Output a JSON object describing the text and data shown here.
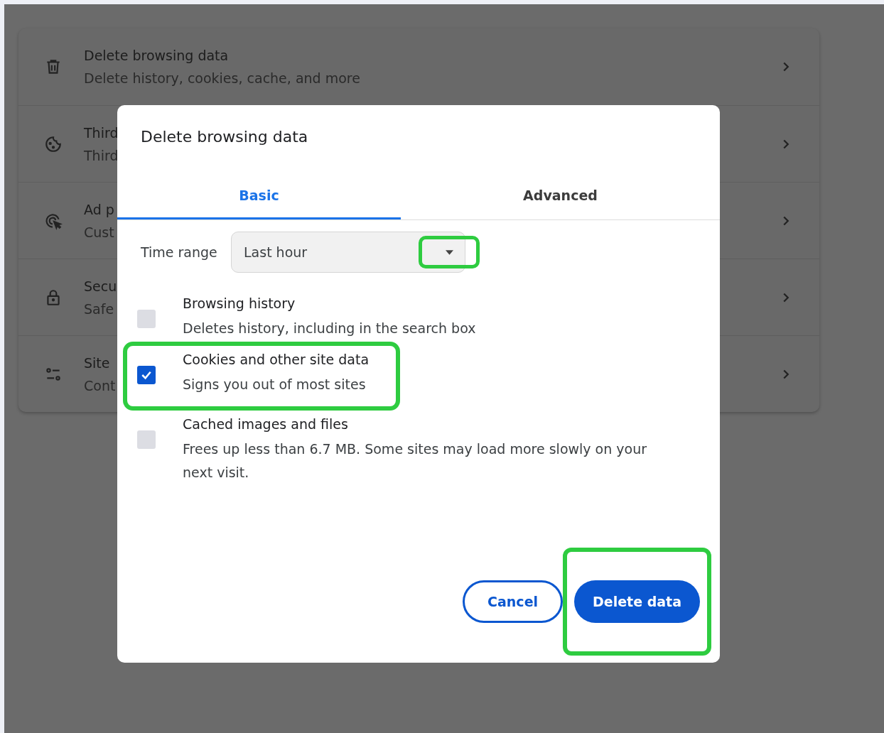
{
  "settings_list": [
    {
      "kind": "trash",
      "title": "Delete browsing data",
      "subtitle": "Delete history, cookies, cache, and more"
    },
    {
      "kind": "cookie",
      "title": "Third",
      "subtitle": "Third"
    },
    {
      "kind": "target",
      "title": "Ad p",
      "subtitle": "Cust"
    },
    {
      "kind": "lock",
      "title": "Secu",
      "subtitle": "Safe"
    },
    {
      "kind": "sliders",
      "title": "Site",
      "subtitle": "Cont"
    }
  ],
  "dialog": {
    "title": "Delete browsing data",
    "tabs": [
      {
        "label": "Basic",
        "selected": true
      },
      {
        "label": "Advanced",
        "selected": false
      }
    ],
    "time_range": {
      "label": "Time range",
      "value": "Last hour",
      "arrow_highlighted": true
    },
    "options": [
      {
        "title": "Browsing history",
        "description": "Deletes history, including in the search box",
        "checked": false,
        "highlighted": false
      },
      {
        "title": "Cookies and other site data",
        "description": "Signs you out of most sites",
        "checked": true,
        "highlighted": true
      },
      {
        "title": "Cached images and files",
        "description": "Frees up less than 6.7 MB. Some sites may load more slowly on your next visit.",
        "checked": false,
        "highlighted": false
      }
    ],
    "buttons": [
      {
        "kind": "secondary",
        "label": "Cancel",
        "highlighted": false
      },
      {
        "kind": "primary",
        "label": "Delete data",
        "highlighted": true
      }
    ]
  }
}
